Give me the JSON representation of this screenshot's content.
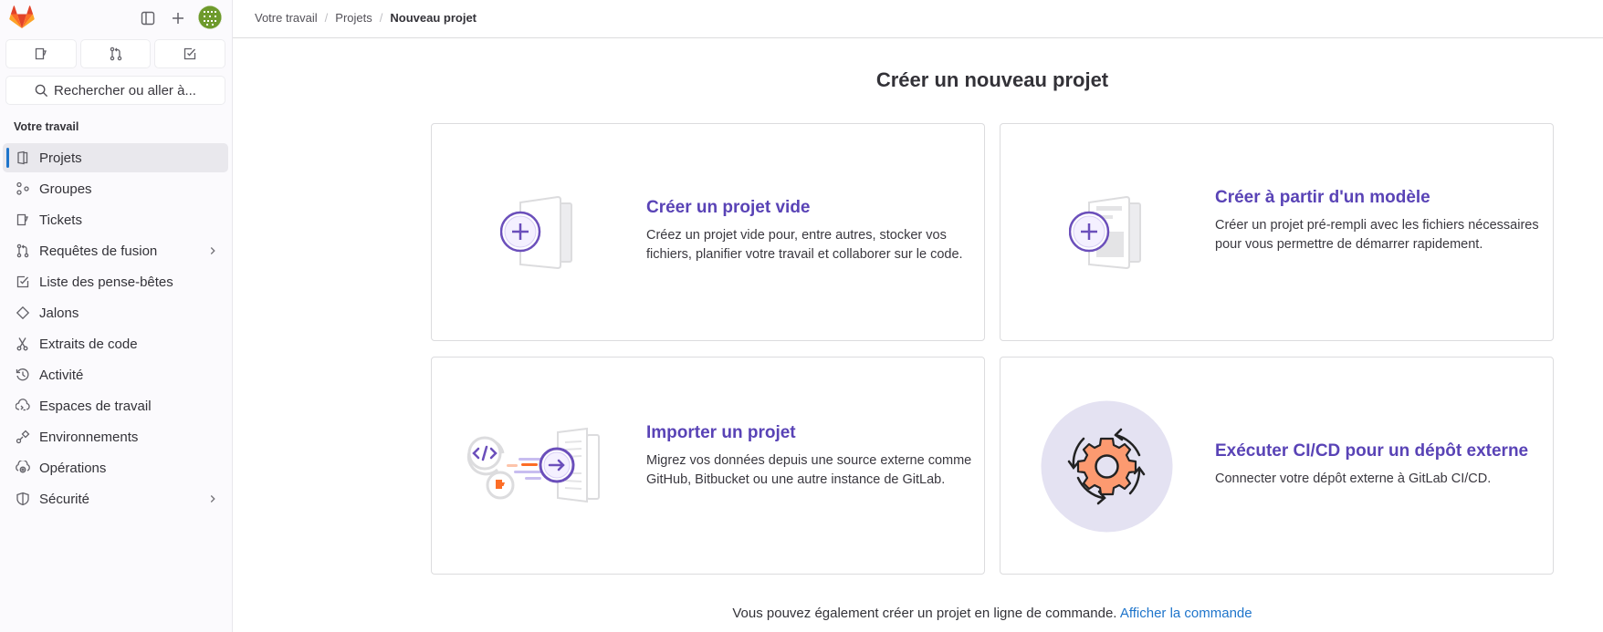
{
  "sidebar": {
    "search_placeholder": "Rechercher ou aller à...",
    "section_title": "Votre travail",
    "items": [
      {
        "label": "Projets",
        "icon": "project-icon",
        "active": true
      },
      {
        "label": "Groupes",
        "icon": "group-icon"
      },
      {
        "label": "Tickets",
        "icon": "issues-icon"
      },
      {
        "label": "Requêtes de fusion",
        "icon": "merge-request-icon",
        "chevron": true
      },
      {
        "label": "Liste des pense-bêtes",
        "icon": "todo-icon"
      },
      {
        "label": "Jalons",
        "icon": "milestone-icon"
      },
      {
        "label": "Extraits de code",
        "icon": "snippet-icon"
      },
      {
        "label": "Activité",
        "icon": "history-icon"
      },
      {
        "label": "Espaces de travail",
        "icon": "workspace-icon"
      },
      {
        "label": "Environnements",
        "icon": "environment-icon"
      },
      {
        "label": "Opérations",
        "icon": "operations-icon"
      },
      {
        "label": "Sécurité",
        "icon": "shield-icon",
        "chevron": true
      }
    ]
  },
  "breadcrumb": {
    "items": [
      "Votre travail",
      "Projets"
    ],
    "current": "Nouveau projet",
    "separator": "/"
  },
  "main": {
    "title": "Créer un nouveau projet",
    "cards": [
      {
        "title": "Créer un projet vide",
        "description": "Créez un projet vide pour, entre autres, stocker vos fichiers, planifier votre travail et collaborer sur le code."
      },
      {
        "title": "Créer à partir d'un modèle",
        "description": "Créer un projet pré-rempli avec les fichiers nécessaires pour vous permettre de démarrer rapidement."
      },
      {
        "title": "Importer un projet",
        "description": "Migrez vos données depuis une source externe comme GitHub, Bitbucket ou une autre instance de GitLab."
      },
      {
        "title": "Exécuter CI/CD pour un dépôt externe",
        "description": "Connecter votre dépôt externe à GitLab CI/CD."
      }
    ],
    "footer_text": "Vous pouvez également créer un projet en ligne de commande.",
    "footer_link": "Afficher la commande"
  },
  "colors": {
    "accent_purple": "#5943b6",
    "link_blue": "#1f75cb",
    "active_indicator": "#1f75cb",
    "gear_orange": "#fc9a70"
  }
}
